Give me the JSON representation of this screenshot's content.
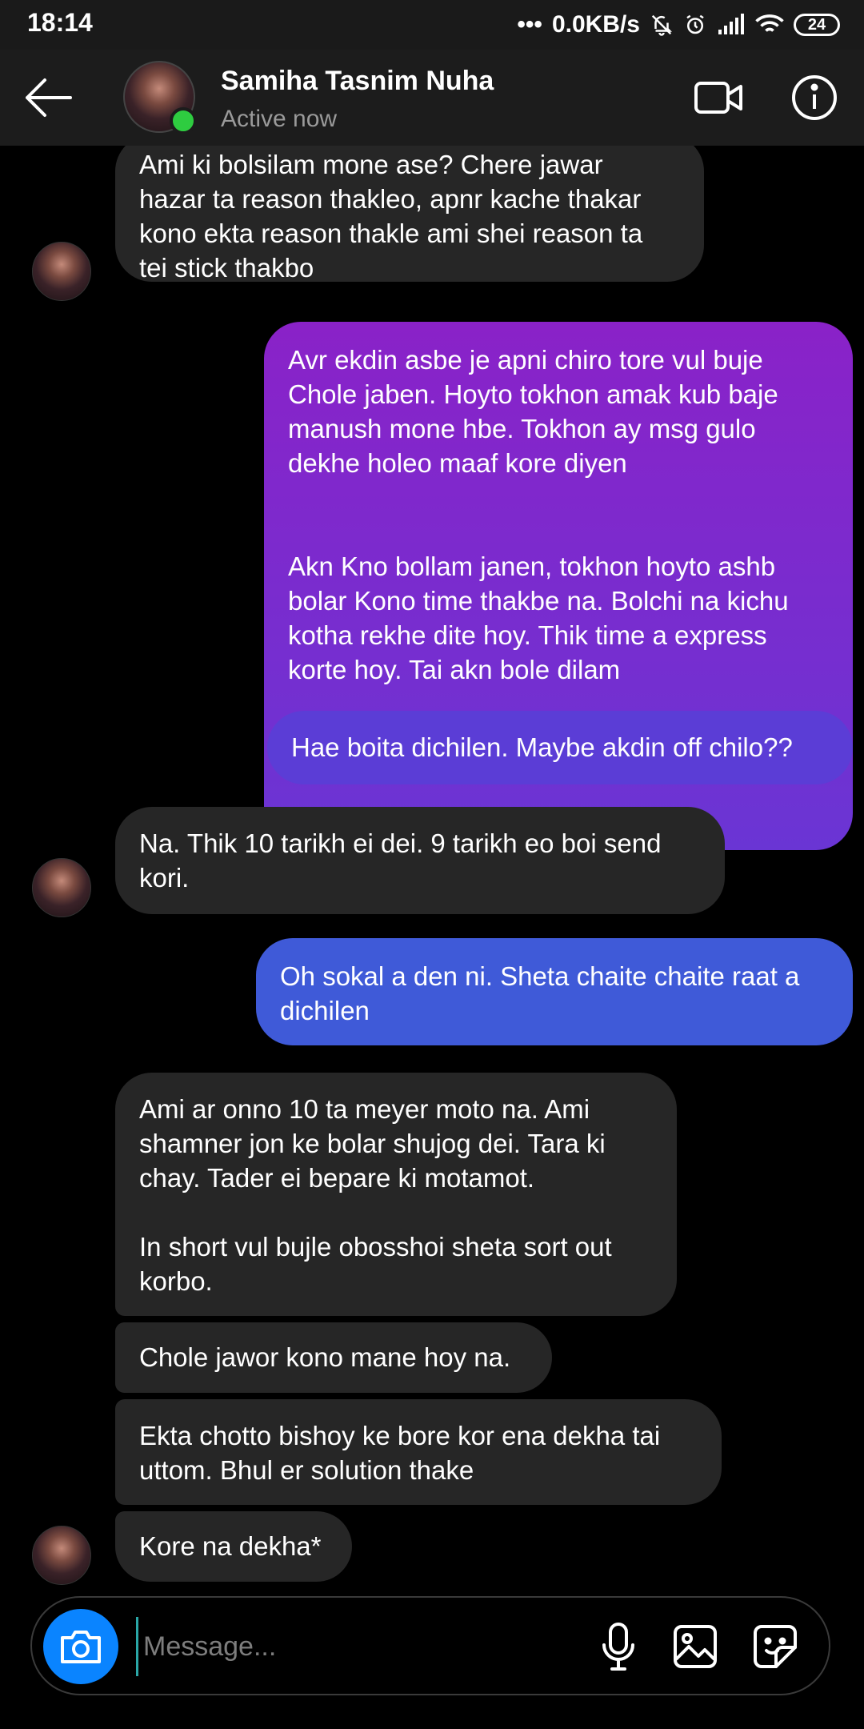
{
  "status_bar": {
    "time": "18:14",
    "network_speed": "0.0KB/s",
    "battery": "24"
  },
  "header": {
    "name": "Samiha Tasnim Nuha",
    "status": "Active now",
    "icons": [
      "back-arrow-icon",
      "video-call-icon",
      "info-icon"
    ]
  },
  "messages": [
    {
      "from": "them",
      "text": "Ami ki bolsilam mone ase? Chere jawar\nhazar ta reason thakleo, apnr kache thakar\nkono ekta reason thakle ami shei reason ta\ntei stick thakbo"
    },
    {
      "from": "me",
      "text": "Avr ekdin asbe je apni chiro tore vul buje\nChole jaben. Hoyto tokhon amak kub baje\nmanush mone hbe. Tokhon ay msg gulo\ndekhe holeo maaf kore diyen\n\n\nAkn Kno bollam janen, tokhon hoyto ashb\nbolar Kono time thakbe na. Bolchi na kichu\nkotha rekhe dite hoy. Thik time a express\nkorte hoy. Tai akn bole dilam"
    },
    {
      "from": "me",
      "text": "Hae boita dichilen. Maybe akdin off chilo??"
    },
    {
      "from": "them",
      "text": "Na. Thik 10 tarikh ei dei. 9 tarikh eo boi send\nkori."
    },
    {
      "from": "me",
      "text": "Oh sokal a den ni. Sheta chaite chaite raat a\ndichilen"
    },
    {
      "from": "them",
      "text": "Ami ar onno 10 ta meyer moto na. Ami\nshamner jon ke bolar shujog dei. Tara ki\nchay. Tader ei bepare ki motamot.\n\nIn short vul bujle obosshoi sheta sort out\nkorbo."
    },
    {
      "from": "them",
      "text": "Chole jawor kono mane hoy na."
    },
    {
      "from": "them",
      "text": "Ekta chotto bishoy ke bore kor ena dekha tai\nuttom. Bhul er solution thake"
    },
    {
      "from": "them",
      "text": "Kore na dekha*"
    }
  ],
  "composer": {
    "placeholder": "Message...",
    "icons": [
      "camera-icon",
      "microphone-icon",
      "gallery-icon",
      "sticker-icon"
    ]
  },
  "colors": {
    "accent": "#0a84ff",
    "incoming_bubble": "#262626",
    "outgoing_top": "#8a22c8",
    "outgoing_bottom": "#3f5ad8",
    "online": "#2ecc40"
  }
}
